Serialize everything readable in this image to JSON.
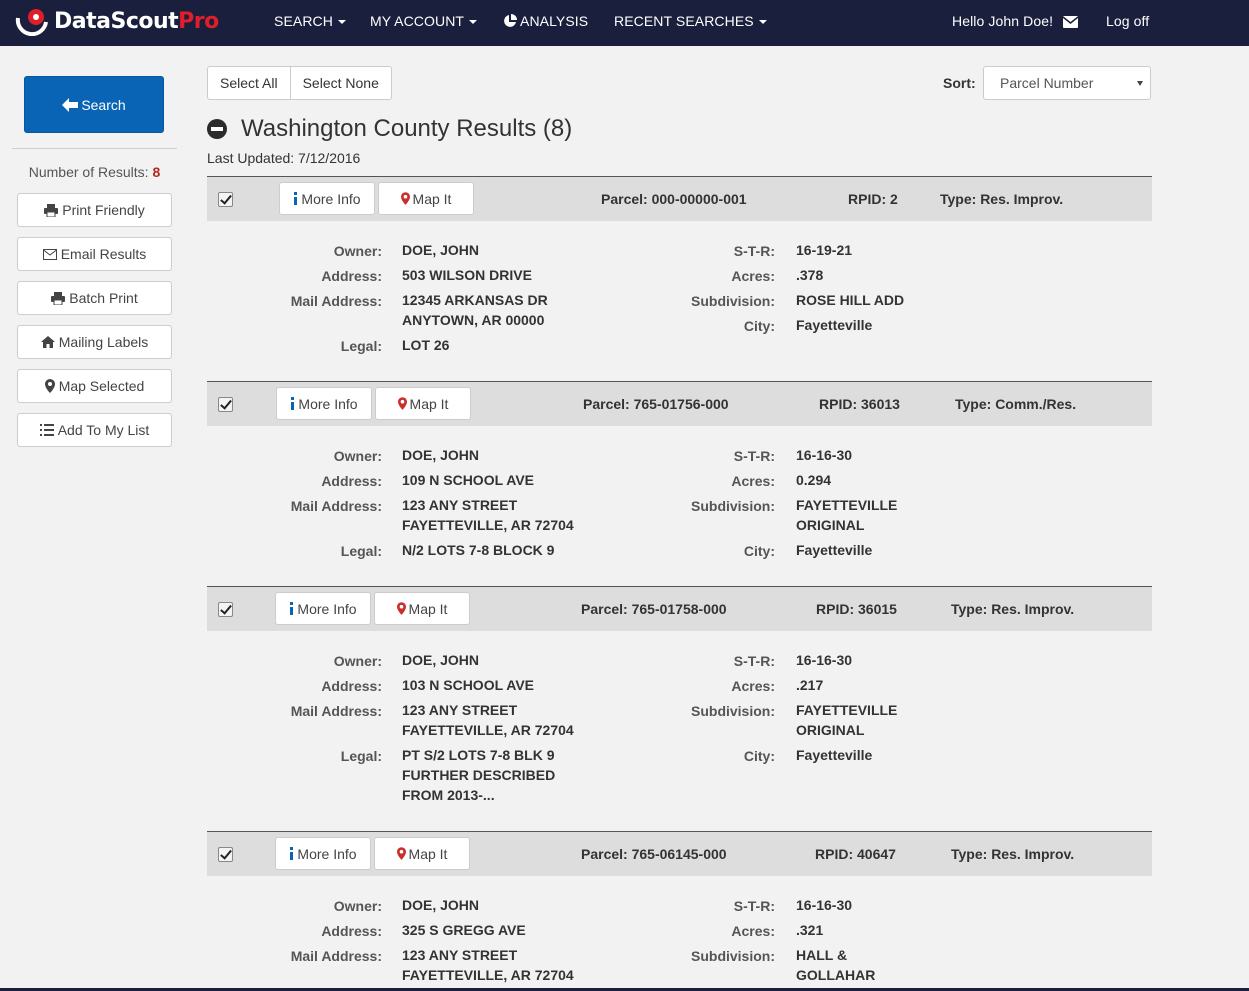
{
  "brand": {
    "name": "DataScout",
    "suffix": "Pro"
  },
  "nav": {
    "search": "SEARCH",
    "my_account": "MY ACCOUNT",
    "analysis": "ANALYSIS",
    "recent_searches": "RECENT SEARCHES",
    "greeting": "Hello John Doe!",
    "logoff": "Log off"
  },
  "sidebar": {
    "search_label": "Search",
    "results_label": "Number of Results:",
    "results_count": "8",
    "buttons": [
      "Print Friendly",
      "Email Results",
      "Batch Print",
      "Mailing Labels",
      "Map Selected",
      "Add To My List"
    ]
  },
  "toolbar": {
    "select_all": "Select All",
    "select_none": "Select None",
    "sort_label": "Sort:",
    "sort_value": "Parcel Number"
  },
  "county": {
    "title": "Washington County Results (8)",
    "last_updated": "Last Updated: 7/12/2016"
  },
  "labels": {
    "more_info": "More Info",
    "map_it": "Map It",
    "owner": "Owner:",
    "address": "Address:",
    "mail_address": "Mail Address:",
    "legal": "Legal:",
    "str": "S-T-R:",
    "acres": "Acres:",
    "subdivision": "Subdivision:",
    "city": "City:"
  },
  "results": [
    {
      "checked": true,
      "parcel": "Parcel: 000-00000-001",
      "rpid": "RPID: 2",
      "type": "Type: Res. Improv.",
      "owner": "DOE, JOHN",
      "address": "503 WILSON DRIVE",
      "mail_line1": "12345 ARKANSAS DR",
      "mail_line2": "ANYTOWN, AR 00000",
      "legal_line1": "LOT 26",
      "legal_line2": "",
      "legal_line3": "",
      "str": "16-19-21",
      "acres": ".378",
      "subdivision_line1": "ROSE HILL ADD",
      "subdivision_line2": "",
      "city": "Fayetteville"
    },
    {
      "checked": true,
      "parcel": "Parcel: 765-01756-000",
      "rpid": "RPID: 36013",
      "type": "Type: Comm./Res.",
      "owner": "DOE, JOHN",
      "address": "109 N SCHOOL AVE",
      "mail_line1": "123 ANY STREET",
      "mail_line2": "FAYETTEVILLE, AR 72704",
      "legal_line1": "N/2 LOTS 7-8 BLOCK 9",
      "legal_line2": "",
      "legal_line3": "",
      "str": "16-16-30",
      "acres": "0.294",
      "subdivision_line1": "FAYETTEVILLE",
      "subdivision_line2": "ORIGINAL",
      "city": "Fayetteville"
    },
    {
      "checked": true,
      "parcel": "Parcel: 765-01758-000",
      "rpid": "RPID: 36015",
      "type": "Type: Res. Improv.",
      "owner": "DOE, JOHN",
      "address": "103 N SCHOOL AVE",
      "mail_line1": "123 ANY STREET",
      "mail_line2": "FAYETTEVILLE, AR 72704",
      "legal_line1": "PT S/2 LOTS 7-8 BLK 9",
      "legal_line2": "FURTHER DESCRIBED",
      "legal_line3": "FROM 2013-...",
      "str": "16-16-30",
      "acres": ".217",
      "subdivision_line1": "FAYETTEVILLE",
      "subdivision_line2": "ORIGINAL",
      "city": "Fayetteville"
    },
    {
      "checked": true,
      "parcel": "Parcel: 765-06145-000",
      "rpid": "RPID: 40647",
      "type": "Type: Res. Improv.",
      "owner": "DOE, JOHN",
      "address": "325 S GREGG AVE",
      "mail_line1": "123 ANY STREET",
      "mail_line2": "FAYETTEVILLE, AR 72704",
      "str": "16-16-30",
      "acres": ".321",
      "subdivision_line1": "HALL &",
      "subdivision_line2": "GOLLAHAR"
    }
  ]
}
